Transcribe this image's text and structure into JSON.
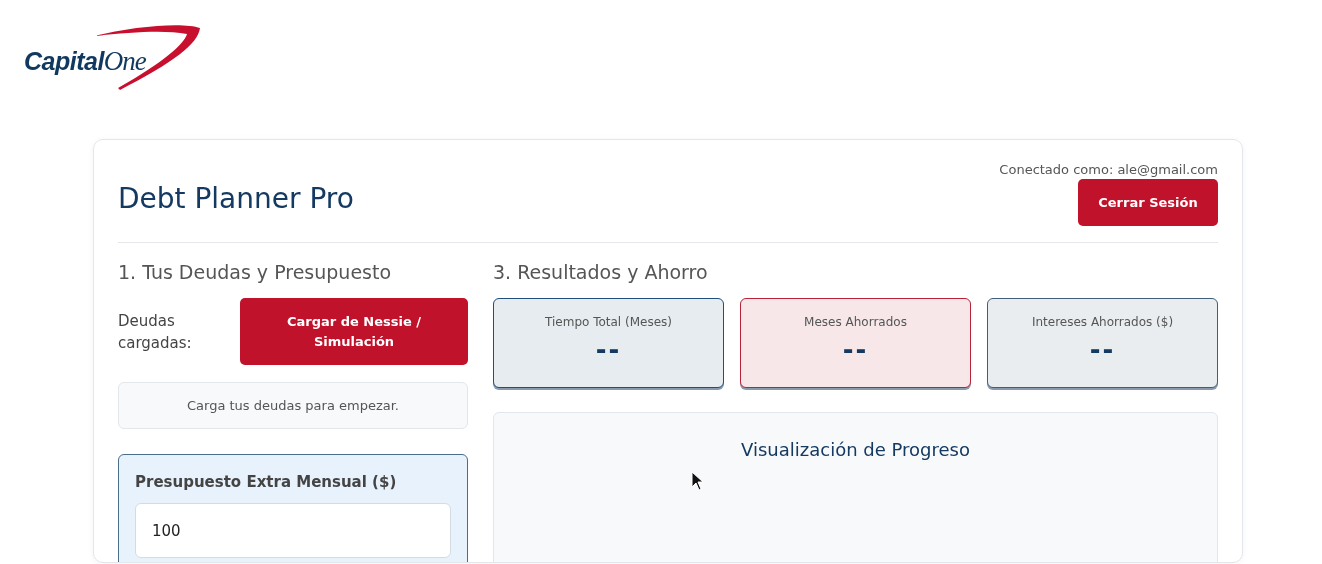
{
  "logo": {
    "word_1": "Capital",
    "word_2": "One"
  },
  "header": {
    "title": "Debt Planner Pro",
    "user_label": "Conectado como: ale@gmail.com",
    "logout_button": "Cerrar Sesión"
  },
  "debts": {
    "heading": "1. Tus Deudas y Presupuesto",
    "label": "Deudas cargadas:",
    "load_button": "Cargar de Nessie / Simulación",
    "empty_message": "Carga tus deudas para empezar."
  },
  "budget": {
    "label": "Presupuesto Extra Mensual ($)",
    "value": "100"
  },
  "results": {
    "heading": "3. Resultados y Ahorro",
    "stats": [
      {
        "label": "Tiempo Total (Meses)",
        "value": "--",
        "color": "#1f4f7a"
      },
      {
        "label": "Meses Ahorrados",
        "value": "--",
        "color": "#b8233a"
      },
      {
        "label": "Intereses Ahorrados ($)",
        "value": "--",
        "color": "#3f5f7a"
      }
    ]
  },
  "progress": {
    "title": "Visualización de Progreso"
  }
}
